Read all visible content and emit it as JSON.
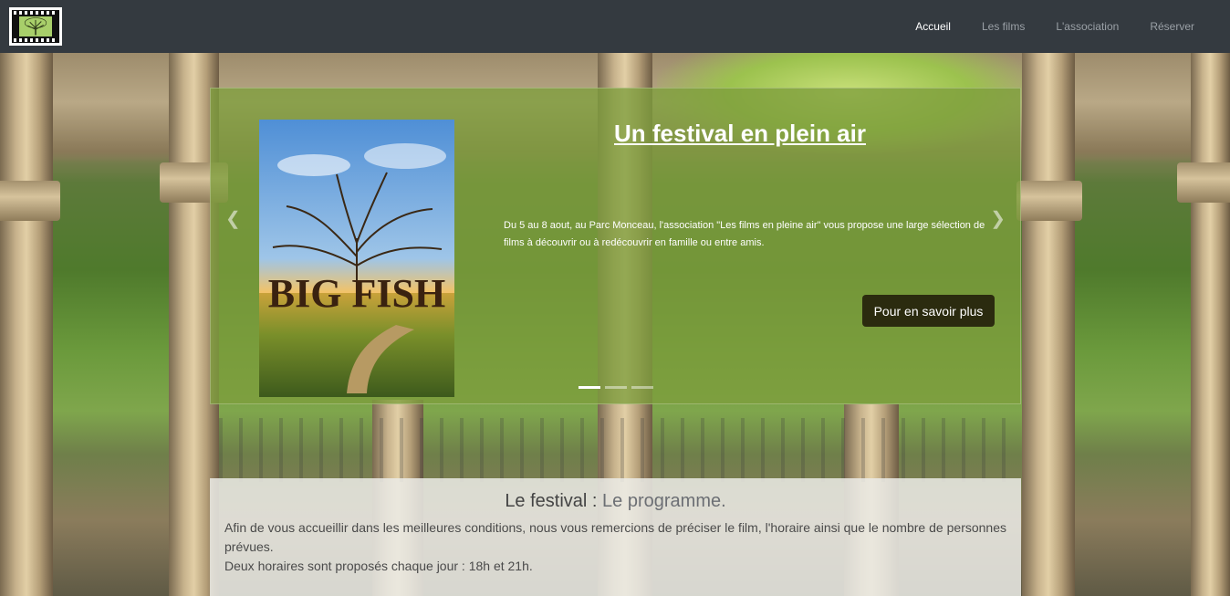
{
  "nav": {
    "links": [
      {
        "label": "Accueil",
        "active": true
      },
      {
        "label": "Les films",
        "active": false
      },
      {
        "label": "L'association",
        "active": false
      },
      {
        "label": "Réserver",
        "active": false
      }
    ]
  },
  "carousel": {
    "poster_text": "BIG FISH",
    "title": "Un festival en plein air",
    "text": "Du 5 au 8 aout, au Parc Monceau, l'association \"Les films en pleine air\" vous propose une large sélection de films à découvrir ou à redécouvrir en famille ou entre amis.",
    "button_label": "Pour en savoir plus",
    "slide_count": 3,
    "active_slide": 1
  },
  "festival": {
    "title": "Le festival :",
    "subtitle": "Le programme.",
    "paragraph1": "Afin de vous accueillir dans les meilleures conditions, nous vous remercions de préciser le film, l'horaire ainsi que le nombre de personnes prévues.",
    "paragraph2": "Deux horaires sont proposés chaque jour : 18h et 21h."
  },
  "colors": {
    "navbar": "#343a40",
    "carousel_overlay": "#7e9e3c",
    "button": "#2b2b0f"
  }
}
